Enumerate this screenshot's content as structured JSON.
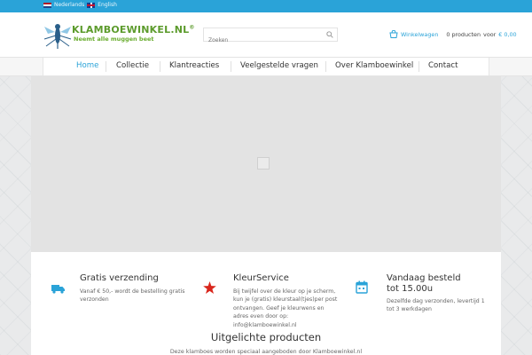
{
  "topbar": {
    "languages": [
      "Nederlands",
      "English"
    ],
    "color": "#2aa3d8"
  },
  "header": {
    "logo_title": "KLAMBOEWINKEL.NL",
    "logo_reg": "®",
    "logo_tagline": "Neemt alle muggen beet",
    "search_placeholder": "Zoeken",
    "cart_link": "Winkelwagen",
    "cart_count": "0 producten",
    "cart_voor": "voor",
    "cart_total": "€ 0,00"
  },
  "nav": {
    "items": [
      {
        "label": "Home",
        "active": true
      },
      {
        "label": "Collectie"
      },
      {
        "label": "Klantreacties"
      },
      {
        "label": "Veelgestelde vragen"
      },
      {
        "label": "Over Klamboewinkel"
      },
      {
        "label": "Contact"
      }
    ]
  },
  "features": [
    {
      "icon": "truck-icon",
      "title": "Gratis verzending",
      "text": "Vanaf € 50,- wordt de bestelling gratis verzonden"
    },
    {
      "icon": "star-icon",
      "title": "KleurService",
      "text": "Bij twijfel over de kleur op je scherm, kun je (gratis) kleurstaal(tjes)per post ontvangen. Geef je kleurwens en adres even door op: info@klamboewinkel.nl"
    },
    {
      "icon": "calendar-icon",
      "title": "Vandaag besteld tot 15.00u",
      "text": "Dezelfde dag verzonden, levertijd 1 tot 3 werkdagen"
    }
  ],
  "featured": {
    "title": "Uitgelichte producten",
    "subtitle": "Deze klamboes worden speciaal aangeboden door Klamboewinkel.nl"
  },
  "colors": {
    "accent": "#2aa3d8",
    "logo_green": "#5c9b2c",
    "star_red": "#d9261c"
  }
}
